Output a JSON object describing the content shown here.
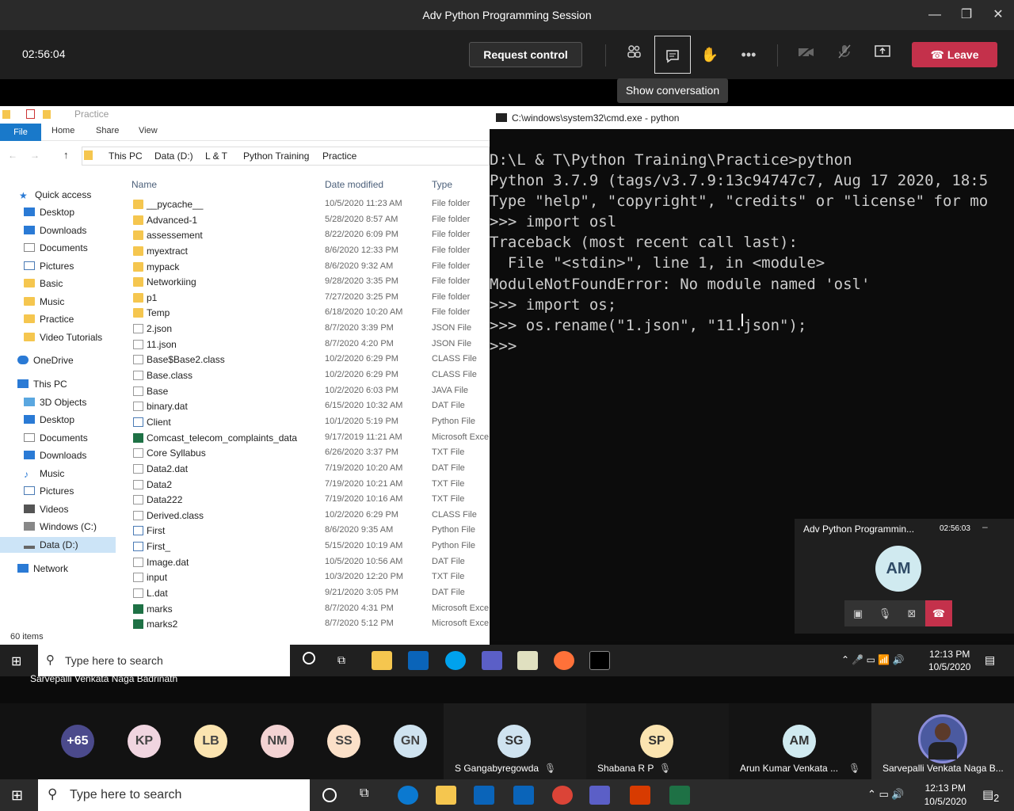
{
  "teams": {
    "window_title": "Adv Python Programming Session",
    "meeting_time": "02:56:04",
    "request_control": "Request control",
    "leave": "Leave",
    "tooltip": "Show conversation"
  },
  "explorer": {
    "title": "Practice",
    "ribbon_tabs": [
      "File",
      "Home",
      "Share",
      "View"
    ],
    "breadcrumb": [
      "This PC",
      "Data (D:)",
      "L & T",
      "Python Training",
      "Practice"
    ],
    "nav": [
      "Quick access",
      "Desktop",
      "Downloads",
      "Documents",
      "Pictures",
      "Basic",
      "Music",
      "Practice",
      "Video Tutorials",
      "OneDrive",
      "This PC",
      "3D Objects",
      "Desktop",
      "Documents",
      "Downloads",
      "Music",
      "Pictures",
      "Videos",
      "Windows (C:)",
      "Data (D:)",
      "Network"
    ],
    "columns": [
      "Name",
      "Date modified",
      "Type"
    ],
    "files": [
      {
        "name": "__pycache__",
        "date": "10/5/2020 11:23 AM",
        "type": "File folder"
      },
      {
        "name": "Advanced-1",
        "date": "5/28/2020 8:57 AM",
        "type": "File folder"
      },
      {
        "name": "assessement",
        "date": "8/22/2020 6:09 PM",
        "type": "File folder"
      },
      {
        "name": "myextract",
        "date": "8/6/2020 12:33 PM",
        "type": "File folder"
      },
      {
        "name": "mypack",
        "date": "8/6/2020 9:32 AM",
        "type": "File folder"
      },
      {
        "name": "Networkiing",
        "date": "9/28/2020 3:35 PM",
        "type": "File folder"
      },
      {
        "name": "p1",
        "date": "7/27/2020 3:25 PM",
        "type": "File folder"
      },
      {
        "name": "Temp",
        "date": "6/18/2020 10:20 AM",
        "type": "File folder"
      },
      {
        "name": "2.json",
        "date": "8/7/2020 3:39 PM",
        "type": "JSON File"
      },
      {
        "name": "11.json",
        "date": "8/7/2020 4:20 PM",
        "type": "JSON File"
      },
      {
        "name": "Base$Base2.class",
        "date": "10/2/2020 6:29 PM",
        "type": "CLASS File"
      },
      {
        "name": "Base.class",
        "date": "10/2/2020 6:29 PM",
        "type": "CLASS File"
      },
      {
        "name": "Base",
        "date": "10/2/2020 6:03 PM",
        "type": "JAVA File"
      },
      {
        "name": "binary.dat",
        "date": "6/15/2020 10:32 AM",
        "type": "DAT File"
      },
      {
        "name": "Client",
        "date": "10/1/2020 5:19 PM",
        "type": "Python File"
      },
      {
        "name": "Comcast_telecom_complaints_data",
        "date": "9/17/2019 11:21 AM",
        "type": "Microsoft Exce"
      },
      {
        "name": "Core Syllabus",
        "date": "6/26/2020 3:37 PM",
        "type": "TXT File"
      },
      {
        "name": "Data2.dat",
        "date": "7/19/2020 10:20 AM",
        "type": "DAT File"
      },
      {
        "name": "Data2",
        "date": "7/19/2020 10:21 AM",
        "type": "TXT File"
      },
      {
        "name": "Data222",
        "date": "7/19/2020 10:16 AM",
        "type": "TXT File"
      },
      {
        "name": "Derived.class",
        "date": "10/2/2020 6:29 PM",
        "type": "CLASS File"
      },
      {
        "name": "First",
        "date": "8/6/2020 9:35 AM",
        "type": "Python File"
      },
      {
        "name": "First_",
        "date": "5/15/2020 10:19 AM",
        "type": "Python File"
      },
      {
        "name": "Image.dat",
        "date": "10/5/2020 10:56 AM",
        "type": "DAT File"
      },
      {
        "name": "input",
        "date": "10/3/2020 12:20 PM",
        "type": "TXT File"
      },
      {
        "name": "L.dat",
        "date": "9/21/2020 3:05 PM",
        "type": "DAT File"
      },
      {
        "name": "marks",
        "date": "8/7/2020 4:31 PM",
        "type": "Microsoft Exce"
      },
      {
        "name": "marks2",
        "date": "8/7/2020 5:12 PM",
        "type": "Microsoft Exce"
      }
    ],
    "status": "60 items"
  },
  "cmd": {
    "title": "C:\\windows\\system32\\cmd.exe - python",
    "lines": [
      "D:\\L & T\\Python Training\\Practice>python",
      "Python 3.7.9 (tags/v3.7.9:13c94747c7, Aug 17 2020, 18:5",
      "Type \"help\", \"copyright\", \"credits\" or \"license\" for mo",
      ">>> import osl",
      "Traceback (most recent call last):",
      "  File \"<stdin>\", line 1, in <module>",
      "ModuleNotFoundError: No module named 'osl'",
      ">>> import os;",
      ">>> os.rename(\"1.json\", \"11.json\");",
      ">>>"
    ]
  },
  "mini": {
    "title": "Adv Python Programmin...",
    "time": "02:56:03",
    "initials": "AM"
  },
  "inner_taskbar": {
    "search": "Type here to search",
    "time": "12:13 PM",
    "date": "10/5/2020"
  },
  "presenter": "Sarvepalli Venkata Naga Badrinath",
  "participants": {
    "avatars": [
      {
        "initials": "+65",
        "color": "#4b4a8c"
      },
      {
        "initials": "KP",
        "color": "#f0d5e0"
      },
      {
        "initials": "LB",
        "color": "#fbe4b0"
      },
      {
        "initials": "NM",
        "color": "#f3d3d3"
      },
      {
        "initials": "SS",
        "color": "#fbe0c8"
      },
      {
        "initials": "GN",
        "color": "#cfe3f0"
      }
    ],
    "tiles": [
      {
        "initials": "SG",
        "name": "S Gangabyregowda",
        "color": "#cfe3f0"
      },
      {
        "initials": "SP",
        "name": "Shabana R P",
        "color": "#fbe4b0"
      },
      {
        "initials": "AM",
        "name": "Arun Kumar Venkata ...",
        "color": "#d0eaf0"
      }
    ],
    "self_name": "Sarvepalli Venkata Naga B..."
  },
  "outer_taskbar": {
    "search": "Type here to search",
    "time": "12:13 PM",
    "date": "10/5/2020",
    "notifications": "2"
  }
}
